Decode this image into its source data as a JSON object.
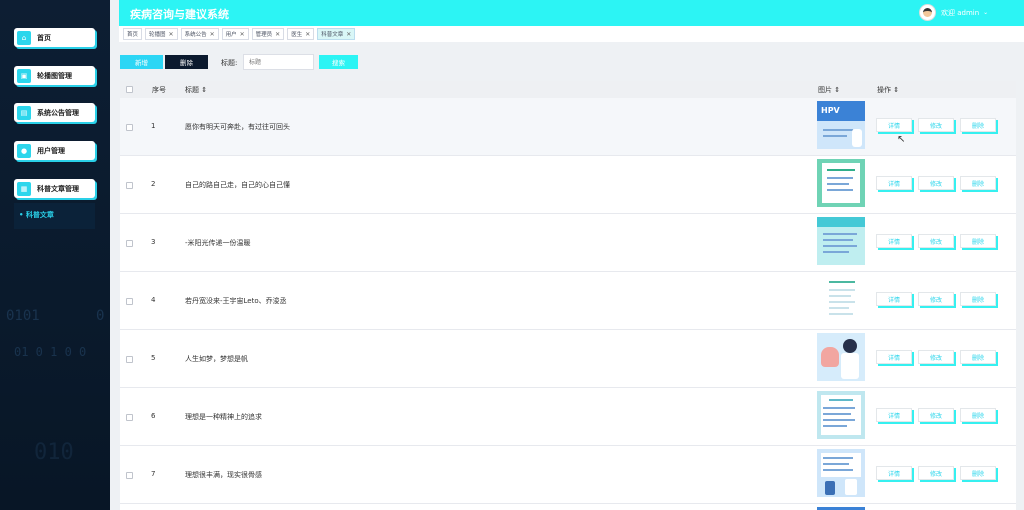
{
  "app": {
    "title": "疾病咨询与建议系统",
    "welcome": "欢迎 admin"
  },
  "sidebar": {
    "items": [
      {
        "label": "首页",
        "icon": "home-icon"
      },
      {
        "label": "轮播图管理",
        "icon": "image-icon"
      },
      {
        "label": "系统公告管理",
        "icon": "notice-icon"
      },
      {
        "label": "用户管理",
        "icon": "user-icon"
      },
      {
        "label": "科普文章管理",
        "icon": "article-icon"
      }
    ],
    "sub_item": "科普文章",
    "decor": [
      "0101",
      "01 0 1 0 0",
      "010"
    ]
  },
  "tabs": [
    {
      "label": "首页",
      "closable": false
    },
    {
      "label": "轮播图",
      "closable": true
    },
    {
      "label": "系统公告",
      "closable": true
    },
    {
      "label": "用户",
      "closable": true
    },
    {
      "label": "管理员",
      "closable": true
    },
    {
      "label": "医生",
      "closable": true
    },
    {
      "label": "科普文章",
      "closable": true,
      "active": true
    }
  ],
  "toolbar": {
    "new_label": "新增",
    "delete_label": "删除",
    "search_label": "标题:",
    "search_placeholder": "标题",
    "search_button": "搜索"
  },
  "table": {
    "headers": {
      "index": "序号",
      "title": "标题 ⇕",
      "image": "图片 ⇕",
      "actions": "操作 ⇕"
    },
    "action_labels": {
      "detail": "详情",
      "edit": "修改",
      "delete": "删除"
    },
    "rows": [
      {
        "index": "1",
        "title": "愿你有明天可奔赴，有过往可回头"
      },
      {
        "index": "2",
        "title": "自己的路自己走，自己的心自己懂"
      },
      {
        "index": "3",
        "title": "-米阳光传递一份温暖"
      },
      {
        "index": "4",
        "title": "若丹宽没来-王宇宙Leto、乔浚丞"
      },
      {
        "index": "5",
        "title": "人生如梦，梦想是帆"
      },
      {
        "index": "6",
        "title": "理想是一种精神上的追求"
      },
      {
        "index": "7",
        "title": "理想很丰满，现实很骨感"
      }
    ]
  },
  "colors": {
    "accent": "#2cf4f4",
    "sidebar_bg": "#0d1e33",
    "dark_button": "#0b1a2e"
  }
}
